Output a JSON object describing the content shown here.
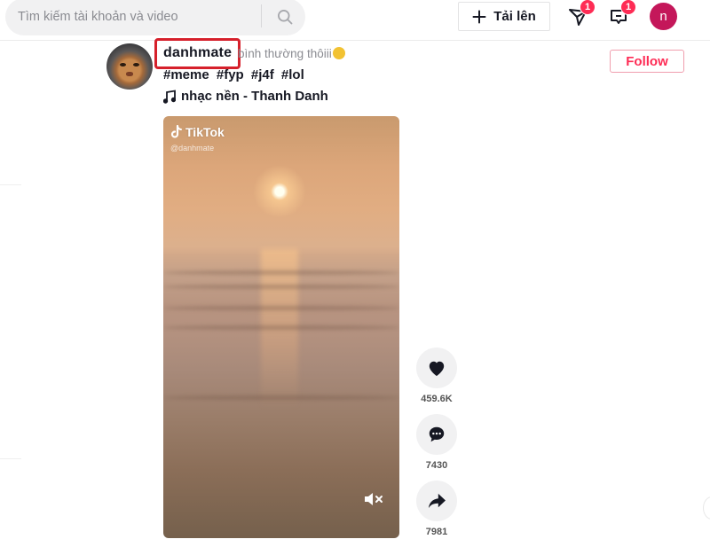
{
  "header": {
    "search": {
      "placeholder": "Tìm kiếm tài khoản và video",
      "value": ""
    },
    "upload_label": "Tải lên",
    "inbox_badge": "1",
    "messages_badge": "1",
    "profile_initial": "n",
    "colors": {
      "brand": "#fe2c55",
      "avatar_bg": "#c4175a"
    }
  },
  "post": {
    "username": "danhmate",
    "caption": "bình thường thôiii",
    "hashtags": [
      "#meme",
      "#fyp",
      "#j4f",
      "#lol"
    ],
    "music": "nhạc nền - Thanh Danh",
    "follow_label": "Follow",
    "video": {
      "watermark_brand": "TikTok",
      "watermark_handle": "@danhmate",
      "muted": true
    },
    "actions": {
      "likes": "459.6K",
      "comments": "7430",
      "shares": "7981"
    }
  }
}
